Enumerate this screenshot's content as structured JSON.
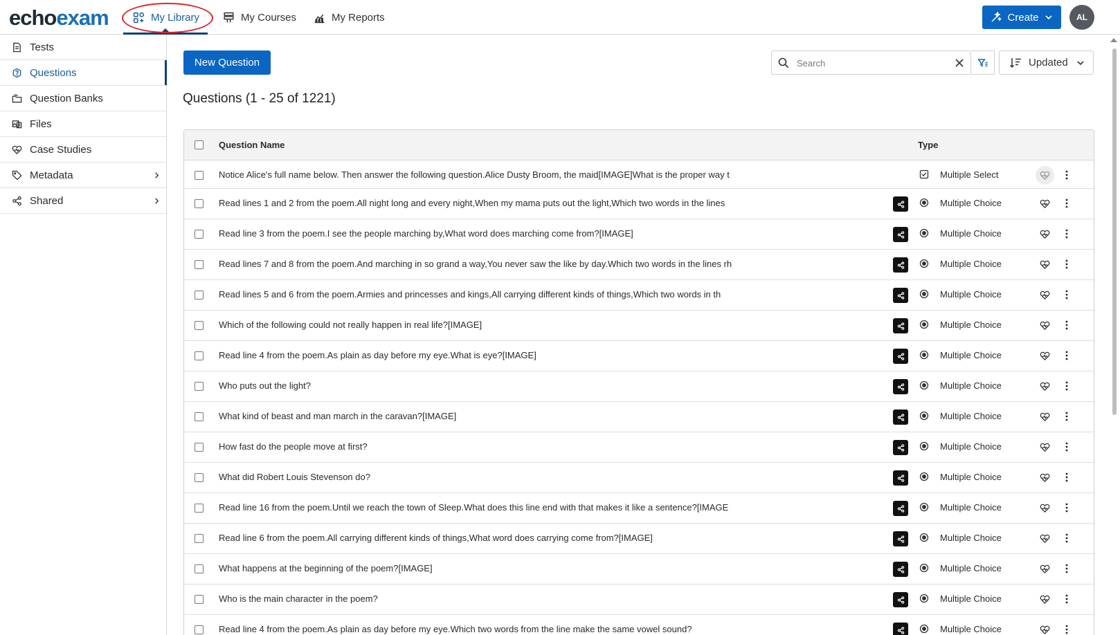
{
  "app": {
    "logo_part1": "echo",
    "logo_part2": "exam",
    "nav": [
      "My Library",
      "My Courses",
      "My Reports"
    ],
    "create_label": "Create",
    "user_initials": "AL"
  },
  "sidebar": {
    "items": [
      "Tests",
      "Questions",
      "Question Banks",
      "Files",
      "Case Studies",
      "Metadata",
      "Shared"
    ]
  },
  "toolbar": {
    "new_question_label": "New Question",
    "search_placeholder": "Search",
    "sort_label": "Updated"
  },
  "page_title": "Questions (1 - 25 of 1221)",
  "table": {
    "headers": {
      "name": "Question Name",
      "type": "Type"
    },
    "rows": [
      {
        "name": "Notice Alice's full name below. Then answer the following question.Alice Dusty Broom, the maid[IMAGE]What is the proper way t",
        "type": "Multiple Select",
        "shared": false
      },
      {
        "name": "Read lines 1 and 2 from the poem.All night long and every night,When my mama puts out the light,Which two words in the lines",
        "type": "Multiple Choice",
        "shared": true
      },
      {
        "name": "Read line 3 from the poem.I see the people marching by,What word does marching come from?[IMAGE]",
        "type": "Multiple Choice",
        "shared": true
      },
      {
        "name": "Read lines 7 and 8 from the poem.And marching in so grand a way,You never saw the like by day.Which two words in the lines rh",
        "type": "Multiple Choice",
        "shared": true
      },
      {
        "name": "Read lines 5 and 6 from the poem.Armies and princesses and kings,All carrying different kinds of things,Which two words in th",
        "type": "Multiple Choice",
        "shared": true
      },
      {
        "name": "Which of the following could not really happen in real life?[IMAGE]",
        "type": "Multiple Choice",
        "shared": true
      },
      {
        "name": "Read line 4 from the poem.As plain as day before my eye.What is eye?[IMAGE]",
        "type": "Multiple Choice",
        "shared": true
      },
      {
        "name": "Who puts out the light?",
        "type": "Multiple Choice",
        "shared": true
      },
      {
        "name": "What kind of beast and man march in the caravan?[IMAGE]",
        "type": "Multiple Choice",
        "shared": true
      },
      {
        "name": "How fast do the people move at first?",
        "type": "Multiple Choice",
        "shared": true
      },
      {
        "name": "What did Robert Louis Stevenson do?",
        "type": "Multiple Choice",
        "shared": true
      },
      {
        "name": "Read line 16 from the poem.Until we reach the town of Sleep.What does this line end with that makes it like a sentence?[IMAGE",
        "type": "Multiple Choice",
        "shared": true
      },
      {
        "name": "Read line 6 from the poem.All carrying different kinds of things,What word does carrying come from?[IMAGE]",
        "type": "Multiple Choice",
        "shared": true
      },
      {
        "name": "What happens at the beginning of the poem?[IMAGE]",
        "type": "Multiple Choice",
        "shared": true
      },
      {
        "name": "Who is the main character in the poem?",
        "type": "Multiple Choice",
        "shared": true
      },
      {
        "name": "Read line 4 from the poem.As plain as day before my eye.Which two words from the line make the same vowel sound?",
        "type": "Multiple Choice",
        "shared": true
      }
    ]
  },
  "colors": {
    "primary": "#0a66c2",
    "active_nav": "#0d3f73",
    "annotation": "#d9262e"
  },
  "icons": {
    "nav": [
      "library-icon",
      "courses-icon",
      "reports-icon"
    ],
    "sidebar": [
      "tests-icon",
      "questions-icon",
      "question-banks-icon",
      "files-icon",
      "case-studies-icon",
      "metadata-icon",
      "shared-icon"
    ]
  }
}
